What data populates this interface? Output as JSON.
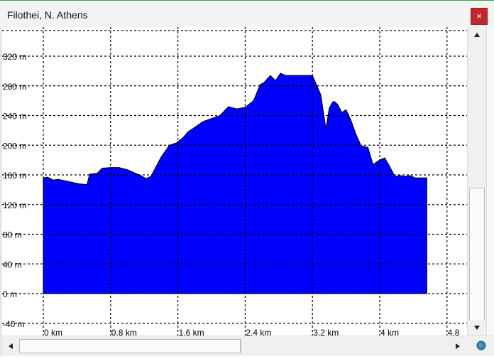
{
  "window": {
    "title": "Filothei, N. Athens",
    "close_glyph": "×"
  },
  "chart_data": {
    "type": "area",
    "title": "",
    "xlabel": "",
    "ylabel": "",
    "xlim": [
      0,
      4.8
    ],
    "ylim": [
      -40,
      320
    ],
    "x_ticks": [
      "0 km",
      "0.8 km",
      "1.6 km",
      "2.4 km",
      "3.2 km",
      "4 km",
      "4.8"
    ],
    "y_ticks": [
      "320 m",
      "280 m",
      "240 m",
      "200 m",
      "160 m",
      "120 m",
      "80 m",
      "40 m",
      "0 m",
      "-40 m"
    ],
    "grid": true,
    "fill_color": "#0000ff",
    "series": [
      {
        "x": [
          0,
          0.05,
          0.12,
          0.18,
          0.3,
          0.42,
          0.52,
          0.55,
          0.64,
          0.7,
          0.8,
          0.9,
          1.0,
          1.08,
          1.16,
          1.22,
          1.28,
          1.34,
          1.4,
          1.5,
          1.58,
          1.66,
          1.72,
          1.8,
          1.9,
          2.0,
          2.1,
          2.2,
          2.3,
          2.4,
          2.5,
          2.58,
          2.62,
          2.7,
          2.76,
          2.82,
          2.88,
          3.0,
          3.1,
          3.2,
          3.3,
          3.36,
          3.4,
          3.44,
          3.46,
          3.5,
          3.55,
          3.6,
          3.66,
          3.72,
          3.78,
          3.86,
          3.92,
          4.0,
          4.06,
          4.12,
          4.18,
          4.24,
          4.3,
          4.36,
          4.42,
          4.48,
          4.56
        ],
        "y": [
          156,
          157,
          153,
          154,
          151,
          148,
          147,
          161,
          162,
          169,
          170,
          170,
          167,
          163,
          159,
          155,
          158,
          171,
          184,
          200,
          203,
          210,
          218,
          224,
          232,
          236,
          240,
          252,
          249,
          251,
          260,
          282,
          284,
          294,
          287,
          297,
          294,
          294,
          294,
          294,
          268,
          222,
          250,
          258,
          259,
          255,
          244,
          248,
          233,
          214,
          199,
          197,
          174,
          180,
          183,
          171,
          158,
          159,
          158,
          159,
          156,
          156,
          156
        ]
      }
    ]
  }
}
